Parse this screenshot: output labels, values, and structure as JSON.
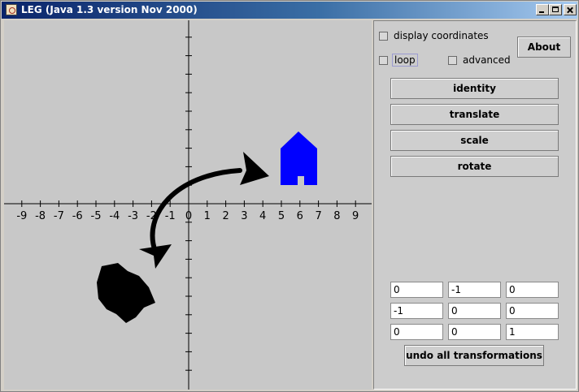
{
  "window": {
    "title": "LEG (Java 1.3 version Nov 2000)"
  },
  "axes": {
    "x_labels": [
      "-9",
      "-8",
      "-7",
      "-6",
      "-5",
      "-4",
      "-3",
      "-2",
      "-1",
      "0",
      "1",
      "2",
      "3",
      "4",
      "5",
      "6",
      "7",
      "8",
      "9"
    ]
  },
  "shapes": {
    "house_color": "#0000ff",
    "shape_color": "#000000",
    "arrow_color": "#000000"
  },
  "controls": {
    "display_coordinates": {
      "label": "display coordinates",
      "checked": false
    },
    "loop": {
      "label": "loop",
      "checked": false
    },
    "advanced": {
      "label": "advanced",
      "checked": false
    },
    "about_button": "About",
    "identity_button": "identity",
    "translate_button": "translate",
    "scale_button": "scale",
    "rotate_button": "rotate",
    "undo_button": "undo all transformations"
  },
  "matrix": [
    [
      "0",
      "-1",
      "0"
    ],
    [
      "-1",
      "0",
      "0"
    ],
    [
      "0",
      "0",
      "1"
    ]
  ]
}
